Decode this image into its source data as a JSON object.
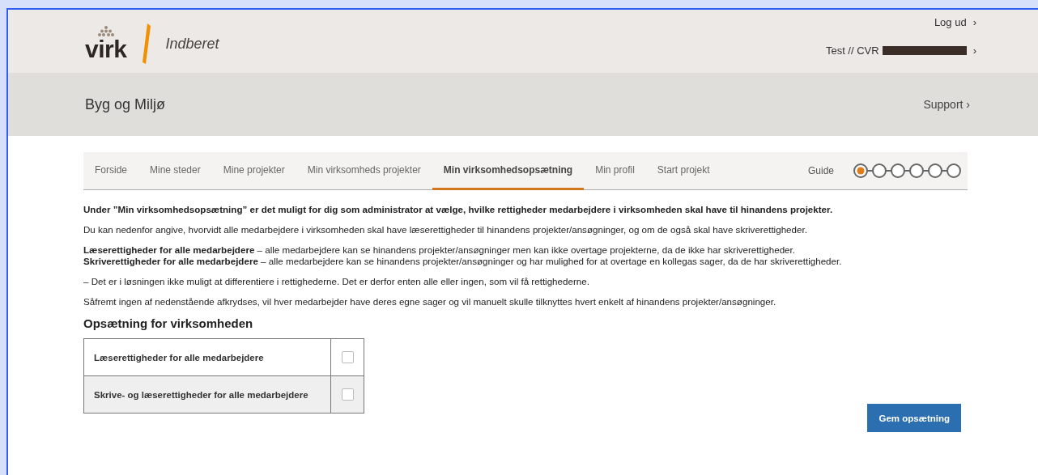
{
  "header": {
    "logo_text": "virk",
    "service": "Indberet",
    "logout": "Log ud",
    "logout_arrow": "›",
    "user": "Test // CVR",
    "user_arrow": "›"
  },
  "subheader": {
    "title": "Byg og Miljø",
    "support": "Support ›"
  },
  "tabs": [
    {
      "label": "Forside",
      "selected": false
    },
    {
      "label": "Mine steder",
      "selected": false
    },
    {
      "label": "Mine projekter",
      "selected": false
    },
    {
      "label": "Min virksomheds projekter",
      "selected": false
    },
    {
      "label": "Min virksomhedsopsætning",
      "selected": true
    },
    {
      "label": "Min profil",
      "selected": false
    },
    {
      "label": "Start projekt",
      "selected": false
    }
  ],
  "guide": {
    "label": "Guide",
    "steps": [
      {
        "selected": true
      },
      {
        "selected": false
      },
      {
        "selected": false
      },
      {
        "selected": false
      },
      {
        "selected": false
      },
      {
        "selected": false
      }
    ]
  },
  "paragraphs": [
    {
      "kind": "bold",
      "text": "Under ”Min virksomhedsopsætning” er det muligt for dig som administrator at vælge, hvilke rettigheder medarbejdere i virksomheden skal have til hinandens projekter."
    },
    {
      "kind": "plain",
      "text": "Du kan nedenfor angive, hvorvidt alle medarbejdere i virksomheden skal have læserettigheder til hinandens projekter/ansøgninger, og om de også skal have skriverettigheder."
    },
    {
      "kind": "tight",
      "text": "**Læserettigheder for alle medarbejdere** – alle medarbejdere kan se hinandens projekter/ansøgninger men kan ikke overtage projekterne, da de ikke har skriverettigheder."
    },
    {
      "kind": "plain",
      "text": "**Skriverettigheder for alle medarbejdere** – alle medarbejdere kan se hinandens projekter/ansøgninger og har mulighed for at overtage en kollegas sager, da de har skriverettigheder."
    },
    {
      "kind": "plain",
      "text": "– Det er i løsningen ikke muligt at differentiere i rettighederne. Det er derfor enten alle eller ingen, som vil få rettighederne."
    },
    {
      "kind": "plain",
      "text": "Såfremt ingen af nedenstående afkrydses, vil hver medarbejder have deres egne sager og vil manuelt skulle tilknyttes hvert enkelt af hinandens projekter/ansøgninger."
    }
  ],
  "settings": {
    "title": "Opsætning for virksomheden",
    "rows": [
      {
        "label": "Læserettigheder for alle medarbejdere",
        "checked": false
      },
      {
        "label": "Skrive- og læserettigheder for alle medarbejdere",
        "checked": false
      }
    ]
  },
  "save_button": "Gem opsætning"
}
